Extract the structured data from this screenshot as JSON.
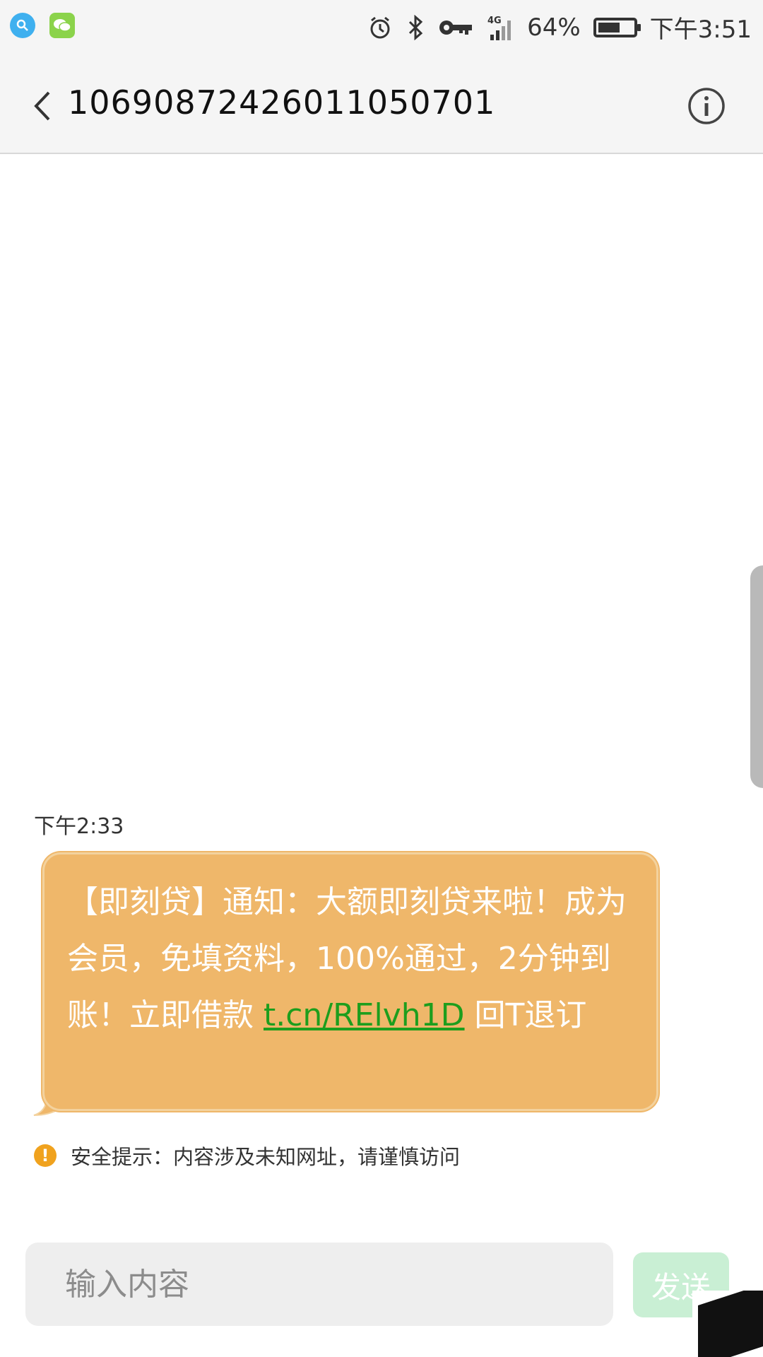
{
  "status_bar": {
    "battery_percent": "64%",
    "battery_level": 0.64,
    "time": "下午3:51",
    "network": "4G",
    "icons": [
      "search-app-icon",
      "wechat-icon",
      "alarm-icon",
      "bluetooth-icon",
      "key-icon",
      "signal-icon",
      "battery-icon"
    ]
  },
  "header": {
    "contact": "10690872426011050701",
    "back_icon": "chevron-left-icon",
    "info_icon": "info-icon"
  },
  "conversation": {
    "message_time": "下午2:33",
    "message": {
      "text_before_link": "【即刻贷】通知：大额即刻贷来啦！成为会员，免填资料，100%通过，2分钟到账！立即借款 ",
      "link": "t.cn/RElvh1D",
      "text_after_link": " 回T退订"
    },
    "security_tip": "安全提示：内容涉及未知网址，请谨慎访问"
  },
  "composer": {
    "placeholder": "输入内容",
    "send_label": "发送"
  },
  "colors": {
    "bubble": "#efb76a",
    "link": "#1d9e1d",
    "warning": "#f0a21e",
    "send_disabled": "#c9efd4"
  }
}
